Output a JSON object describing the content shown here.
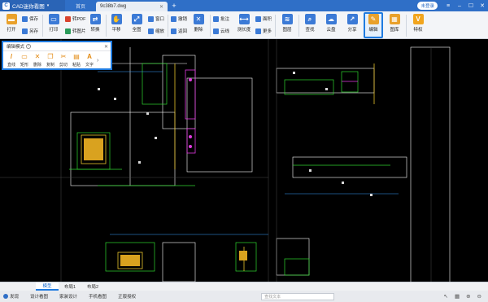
{
  "titlebar": {
    "app_name": "CAD迷你看图",
    "home_tab": "首页",
    "file_tab": "9c38b7.dwg",
    "login": "未登录"
  },
  "toolbar": {
    "open": "打开",
    "save": "保存",
    "save_as": "另存",
    "print": "打印",
    "to_pdf": "转PDF",
    "to_image": "转图片",
    "convert": "转换",
    "pan": "平移",
    "full": "全图",
    "window": "窗口",
    "zoom": "缩放",
    "undo": "撤销",
    "back": "返回",
    "delete": "删除",
    "annotate": "批注",
    "measure_len": "测长度",
    "area": "面积",
    "more": "更多",
    "layers": "图层",
    "find": "查找",
    "cloud": "云盘",
    "share": "分享",
    "edit": "编辑",
    "library": "图库",
    "special": "特权"
  },
  "edit_panel": {
    "title": "编辑模式",
    "tools": [
      {
        "label": "直线",
        "icon": "/"
      },
      {
        "label": "矩形",
        "icon": "▭"
      },
      {
        "label": "删除",
        "icon": "✕"
      },
      {
        "label": "复制",
        "icon": "❐"
      },
      {
        "label": "剪切",
        "icon": "✂"
      },
      {
        "label": "粘贴",
        "icon": "▤"
      },
      {
        "label": "文字",
        "icon": "A"
      }
    ]
  },
  "layout_tabs": [
    "模型",
    "布局1",
    "布局2"
  ],
  "statusbar": {
    "items": [
      "发现",
      "设计看图",
      "家装设计",
      "手机看图",
      "正版授权"
    ],
    "search_placeholder": "查找文本"
  },
  "colors": {
    "accent": "#1f7be0",
    "titlebar": "#2f6fc7",
    "canvas": "#000000"
  }
}
